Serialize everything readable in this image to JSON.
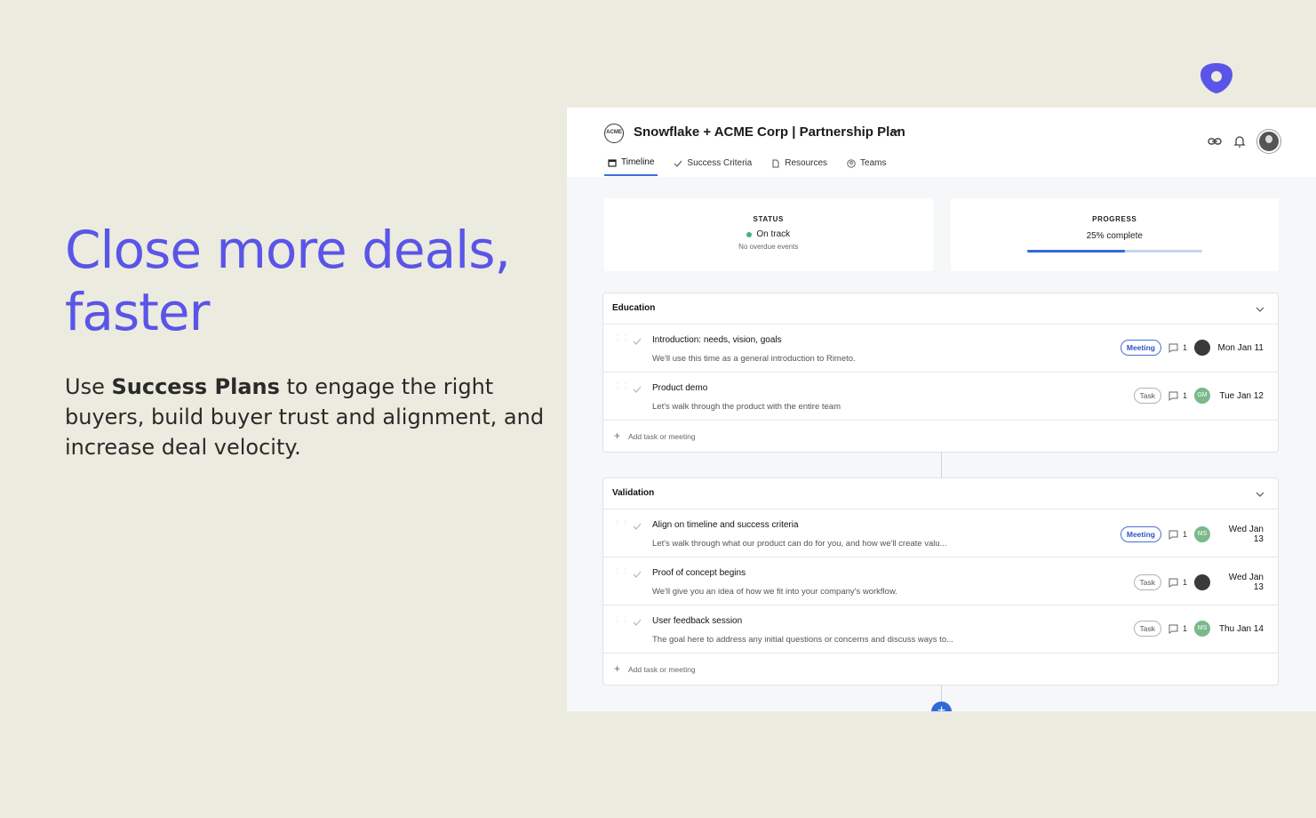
{
  "hero": {
    "title": "Close more deals, faster",
    "desc_prefix": "Use ",
    "desc_bold": "Success Plans",
    "desc_suffix": " to engage the right buyers, build buyer trust and alignment, and increase deal velocity."
  },
  "colors": {
    "accent": "#5a55e8",
    "primary_blue": "#2f6ad9",
    "status_green": "#4caf7d"
  },
  "app": {
    "company_logo_text": "ACME",
    "title": "Snowflake + ACME Corp | Partnership Plan",
    "tabs": [
      {
        "label": "Timeline",
        "icon": "calendar-icon",
        "active": true
      },
      {
        "label": "Success Criteria",
        "icon": "check-icon",
        "active": false
      },
      {
        "label": "Resources",
        "icon": "document-icon",
        "active": false
      },
      {
        "label": "Teams",
        "icon": "user-circle-icon",
        "active": false
      }
    ],
    "status": {
      "label": "STATUS",
      "value": "On track",
      "sub": "No overdue events"
    },
    "progress": {
      "label": "PROGRESS",
      "text": "25% complete",
      "fraction": 0.56
    },
    "sections": [
      {
        "title": "Education",
        "tasks": [
          {
            "name": "Introduction: needs, vision, goals",
            "desc": "We'll use this time as a general introduction to Rimeto.",
            "type": "Meeting",
            "comments": "1",
            "assignee": "",
            "date": "Mon Jan 11"
          },
          {
            "name": "Product demo",
            "desc": "Let's walk through the product with the entire team",
            "type": "Task",
            "comments": "1",
            "assignee": "GM",
            "date": "Tue Jan 12"
          }
        ],
        "add_label": "Add task or meeting"
      },
      {
        "title": "Validation",
        "tasks": [
          {
            "name": "Align on timeline and success criteria",
            "desc": "Let's walk through what our product can do for you, and how we'll create valu...",
            "type": "Meeting",
            "comments": "1",
            "assignee": "MS",
            "date": "Wed Jan 13"
          },
          {
            "name": "Proof of concept begins",
            "desc": "We'll give you an idea of how we fit into your company's workflow.",
            "type": "Task",
            "comments": "1",
            "assignee": "",
            "date": "Wed Jan 13"
          },
          {
            "name": "User feedback session",
            "desc": "The goal here to address any initial questions or concerns and discuss ways to...",
            "type": "Task",
            "comments": "1",
            "assignee": "MS",
            "date": "Thu Jan 14"
          }
        ],
        "add_label": "Add task or meeting"
      }
    ]
  }
}
